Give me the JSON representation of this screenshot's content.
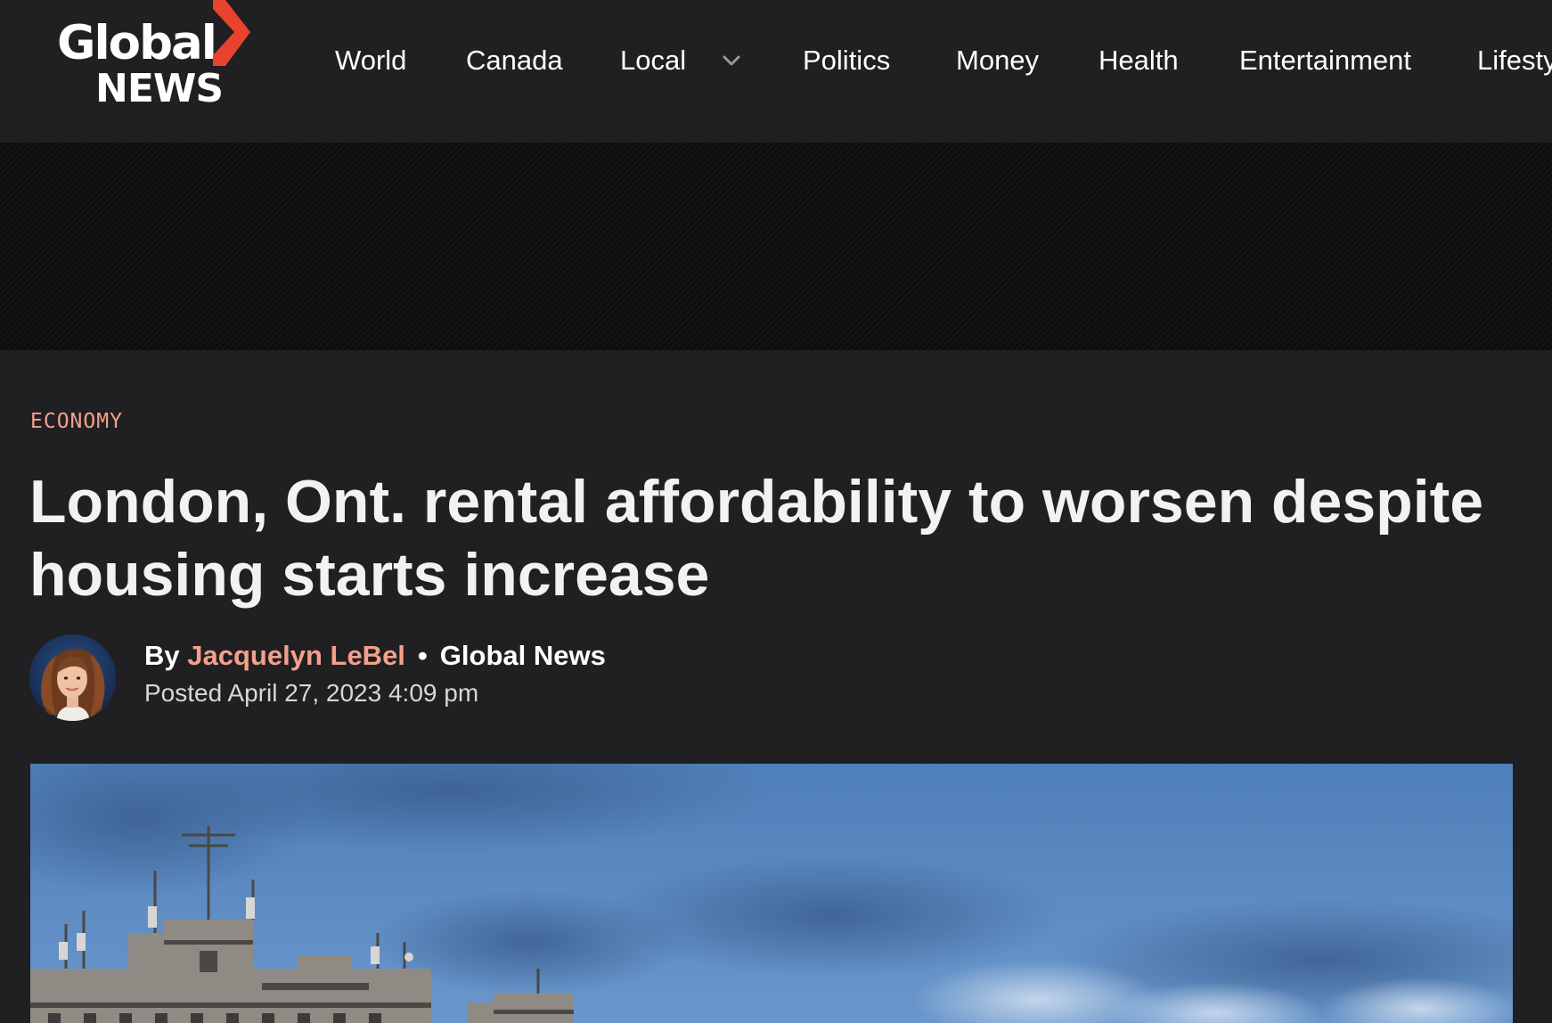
{
  "site": {
    "logo_top": "Global",
    "logo_bottom": "NEWS",
    "brand_red": "#e8432c"
  },
  "nav": {
    "items": [
      {
        "label": "World"
      },
      {
        "label": "Canada"
      },
      {
        "label": "Local",
        "has_dropdown": true
      },
      {
        "label": "Politics"
      },
      {
        "label": "Money"
      },
      {
        "label": "Health"
      },
      {
        "label": "Entertainment"
      },
      {
        "label": "Lifestyle"
      }
    ],
    "dropdown_icon": "chevron-down-icon"
  },
  "article": {
    "category": "ECONOMY",
    "headline": "London, Ont. rental affordability to worsen despite housing starts increase",
    "byline_prefix": "By",
    "author": "Jacquelyn LeBel",
    "separator": "•",
    "source": "Global News",
    "posted": "Posted April 27, 2023 4:09 pm",
    "accent_color": "#f2a08c"
  },
  "hero_image": {
    "description_icon": "hero-photo"
  }
}
